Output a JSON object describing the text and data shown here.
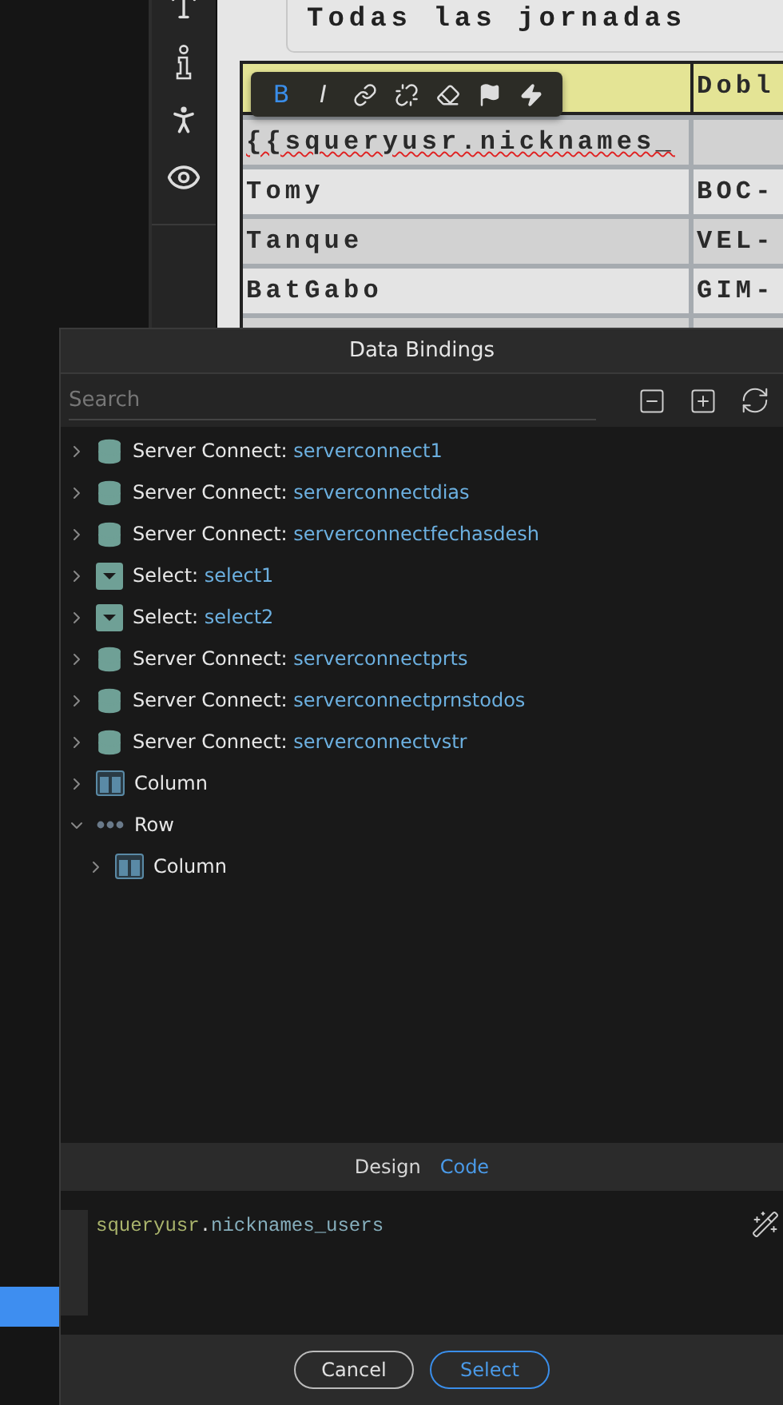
{
  "page": {
    "heading": "Todas las jornadas",
    "table": {
      "header": {
        "column_2": "Dobl"
      },
      "rows": [
        [
          "{{squeryusr.nicknames_",
          null
        ],
        [
          "Tomy",
          "BOC-"
        ],
        [
          "Tanque",
          "VEL-"
        ],
        [
          "BatGabo",
          "GIM-"
        ],
        [
          null,
          null
        ]
      ]
    },
    "format_toolbar": [
      {
        "label": "B",
        "selected": true
      },
      {
        "label": "I",
        "selected": false
      }
    ]
  },
  "dialog": {
    "title": "Data Bindings",
    "search": {
      "placeholder": "Search"
    },
    "tree": [
      {
        "kind": "server",
        "label": "Server Connect:",
        "name": "serverconnect1",
        "expanded": false
      },
      {
        "kind": "server",
        "label": "Server Connect:",
        "name": "serverconnectdias",
        "expanded": false
      },
      {
        "kind": "server",
        "label": "Server Connect:",
        "name": "serverconnectfechasdesh",
        "expanded": false
      },
      {
        "kind": "select",
        "label": "Select:",
        "name": "select1",
        "expanded": false
      },
      {
        "kind": "select",
        "label": "Select:",
        "name": "select2",
        "expanded": false
      },
      {
        "kind": "server",
        "label": "Server Connect:",
        "name": "serverconnectprts",
        "expanded": false
      },
      {
        "kind": "server",
        "label": "Server Connect:",
        "name": "serverconnectprnstodos",
        "expanded": false
      },
      {
        "kind": "server",
        "label": "Server Connect:",
        "name": "serverconnectvstr",
        "expanded": false
      },
      {
        "kind": "column",
        "label": "Column",
        "expanded": false
      },
      {
        "kind": "row",
        "label": "Row",
        "expanded": true,
        "children": [
          {
            "kind": "column",
            "label": "Column",
            "expanded": false
          }
        ]
      }
    ],
    "tabs": [
      {
        "label": "Design",
        "selected": false
      },
      {
        "label": "Code",
        "selected": true
      }
    ],
    "code": [
      {
        "kind": "object",
        "text": "squeryusr"
      },
      {
        "kind": "punct",
        "text": "."
      },
      {
        "kind": "property",
        "text": "nicknames_users"
      }
    ],
    "buttons": [
      {
        "label": "Cancel",
        "primary": false
      },
      {
        "label": "Select",
        "primary": true
      }
    ]
  }
}
